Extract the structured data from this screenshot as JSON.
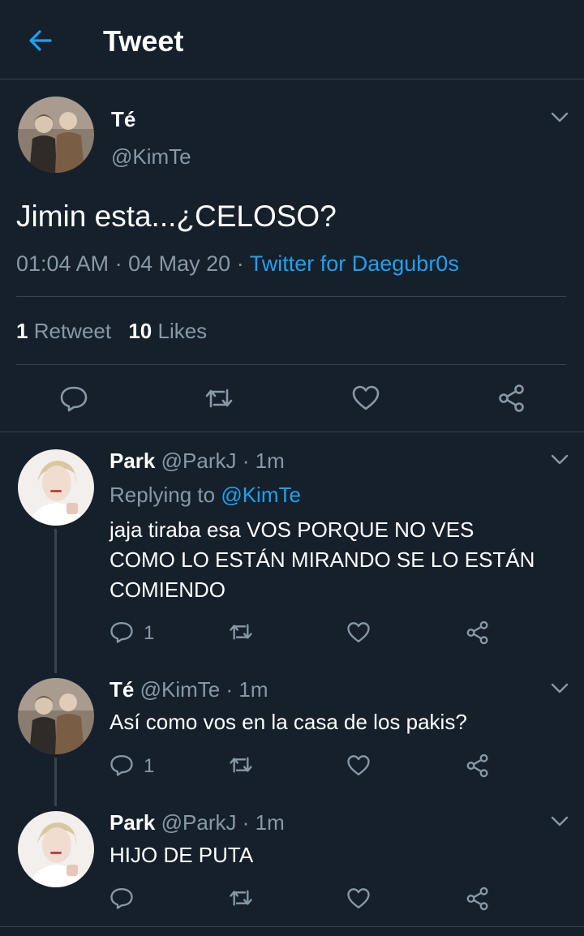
{
  "header": {
    "title": "Tweet",
    "back_icon": "arrow-left-icon"
  },
  "main_tweet": {
    "display_name": "Té",
    "handle": "@KimTe",
    "text": "Jimin esta...¿CELOSO?",
    "time": "01:04 AM",
    "dot1": "·",
    "date": "04 May 20",
    "dot2": "·",
    "source": "Twitter for Daegubr0s",
    "retweets_count": "1",
    "retweets_label": "Retweet",
    "likes_count": "10",
    "likes_label": "Likes"
  },
  "replies": [
    {
      "display_name": "Park",
      "handle": "@ParkJ",
      "dot": "·",
      "time": "1m",
      "replying_prefix": "Replying to",
      "replying_to": "@KimTe",
      "lines": [
        "jaja tiraba esa VOS PORQUE NO VES",
        "COMO LO ESTÁN MIRANDO SE LO ESTÁN",
        "COMIENDO"
      ],
      "reply_count": "1"
    },
    {
      "display_name": "Té",
      "handle": "@KimTe",
      "dot": "·",
      "time": "1m",
      "lines": [
        "Así como vos en la casa de los pakis?"
      ],
      "reply_count": "1"
    },
    {
      "display_name": "Park",
      "handle": "@ParkJ",
      "dot": "·",
      "time": "1m",
      "lines": [
        "HIJO DE PUTA"
      ],
      "reply_count": ""
    }
  ],
  "colors": {
    "background": "#15202b",
    "accent": "#1da1f2",
    "muted": "#8899a6",
    "divider": "#38444d"
  }
}
